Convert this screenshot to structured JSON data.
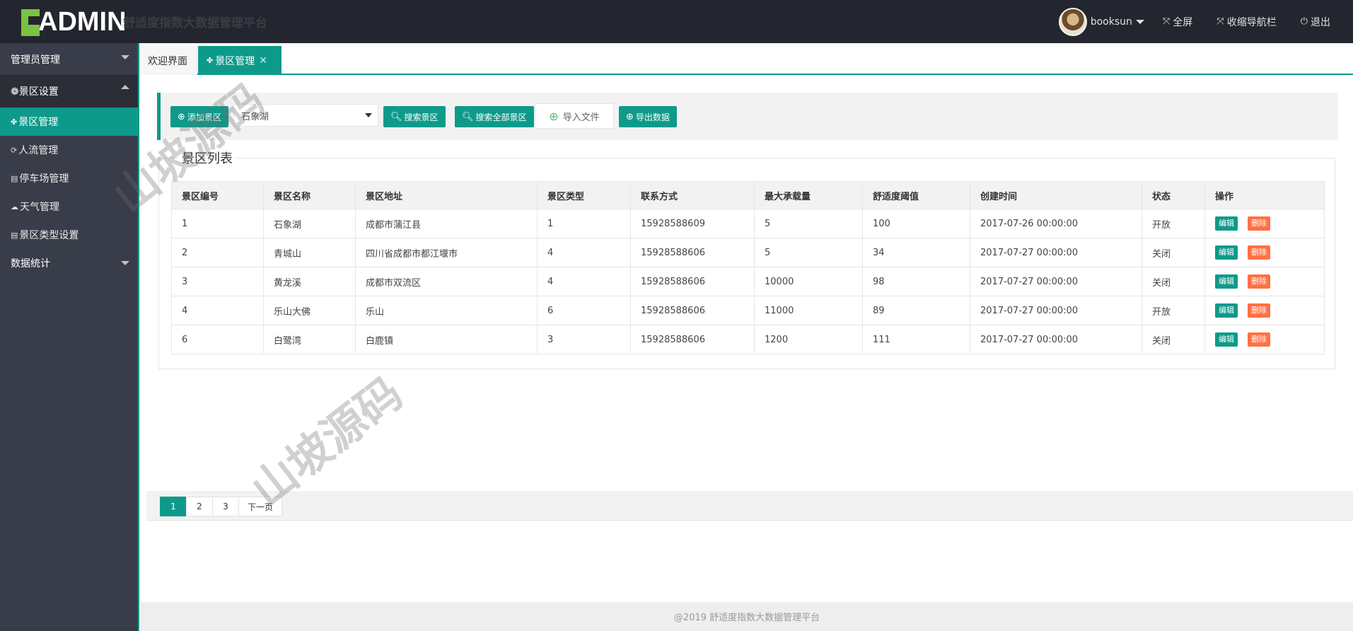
{
  "header": {
    "logo_text": "ADMIN",
    "app_title": "舒适度指数大数据管理平台",
    "user": "booksun",
    "fullscreen_label": "全屏",
    "collapse_label": "收缩导航栏",
    "logout_label": "退出"
  },
  "sidebar": {
    "groups": [
      {
        "label": "管理员管理"
      },
      {
        "label": "❁景区设置"
      },
      {
        "label": "数据统计"
      }
    ],
    "items": [
      {
        "label": "景区管理",
        "icon": "✤"
      },
      {
        "label": "人流管理",
        "icon": "⟳"
      },
      {
        "label": "停车场管理",
        "icon": "▤"
      },
      {
        "label": "天气管理",
        "icon": "☁"
      },
      {
        "label": "景区类型设置",
        "icon": "▤"
      }
    ]
  },
  "tabs": [
    {
      "label": "欢迎界面"
    },
    {
      "label": "景区管理",
      "icon": "✤"
    }
  ],
  "toolbar": {
    "add_label": "添加景区",
    "select_value": "石象湖",
    "search_label": "搜索景区",
    "search_all_label": "搜索全部景区",
    "import_label": "导入文件",
    "export_label": "导出数据"
  },
  "list": {
    "legend": "景区列表",
    "columns": [
      "景区编号",
      "景区名称",
      "景区地址",
      "景区类型",
      "联系方式",
      "最大承载量",
      "舒适度阈值",
      "创建时间",
      "状态",
      "操作"
    ],
    "rows": [
      [
        "1",
        "石象湖",
        "成都市蒲江县",
        "1",
        "15928588609",
        "5",
        "100",
        "2017-07-26 00:00:00",
        "开放"
      ],
      [
        "2",
        "青城山",
        "四川省成都市都江堰市",
        "4",
        "15928588606",
        "5",
        "34",
        "2017-07-27 00:00:00",
        "关闭"
      ],
      [
        "3",
        "黄龙溪",
        "成都市双流区",
        "4",
        "15928588606",
        "10000",
        "98",
        "2017-07-27 00:00:00",
        "关闭"
      ],
      [
        "4",
        "乐山大佛",
        "乐山",
        "6",
        "15928588606",
        "11000",
        "89",
        "2017-07-27 00:00:00",
        "开放"
      ],
      [
        "6",
        "白鹭湾",
        "白鹿镇",
        "3",
        "15928588606",
        "1200",
        "111",
        "2017-07-27 00:00:00",
        "关闭"
      ]
    ],
    "edit_label": "编辑",
    "delete_label": "删除"
  },
  "pager": {
    "pages": [
      "1",
      "2",
      "3"
    ],
    "next_label": "下一页"
  },
  "footer": {
    "text": "@2019 舒适度指数大数据管理平台"
  },
  "watermark": "山坡源码",
  "colors": {
    "accent": "#0e9a8a",
    "header_bg": "#23262e",
    "sidebar_bg": "#393d49",
    "delete": "#ff7043",
    "logo_green": "#7cc242"
  }
}
